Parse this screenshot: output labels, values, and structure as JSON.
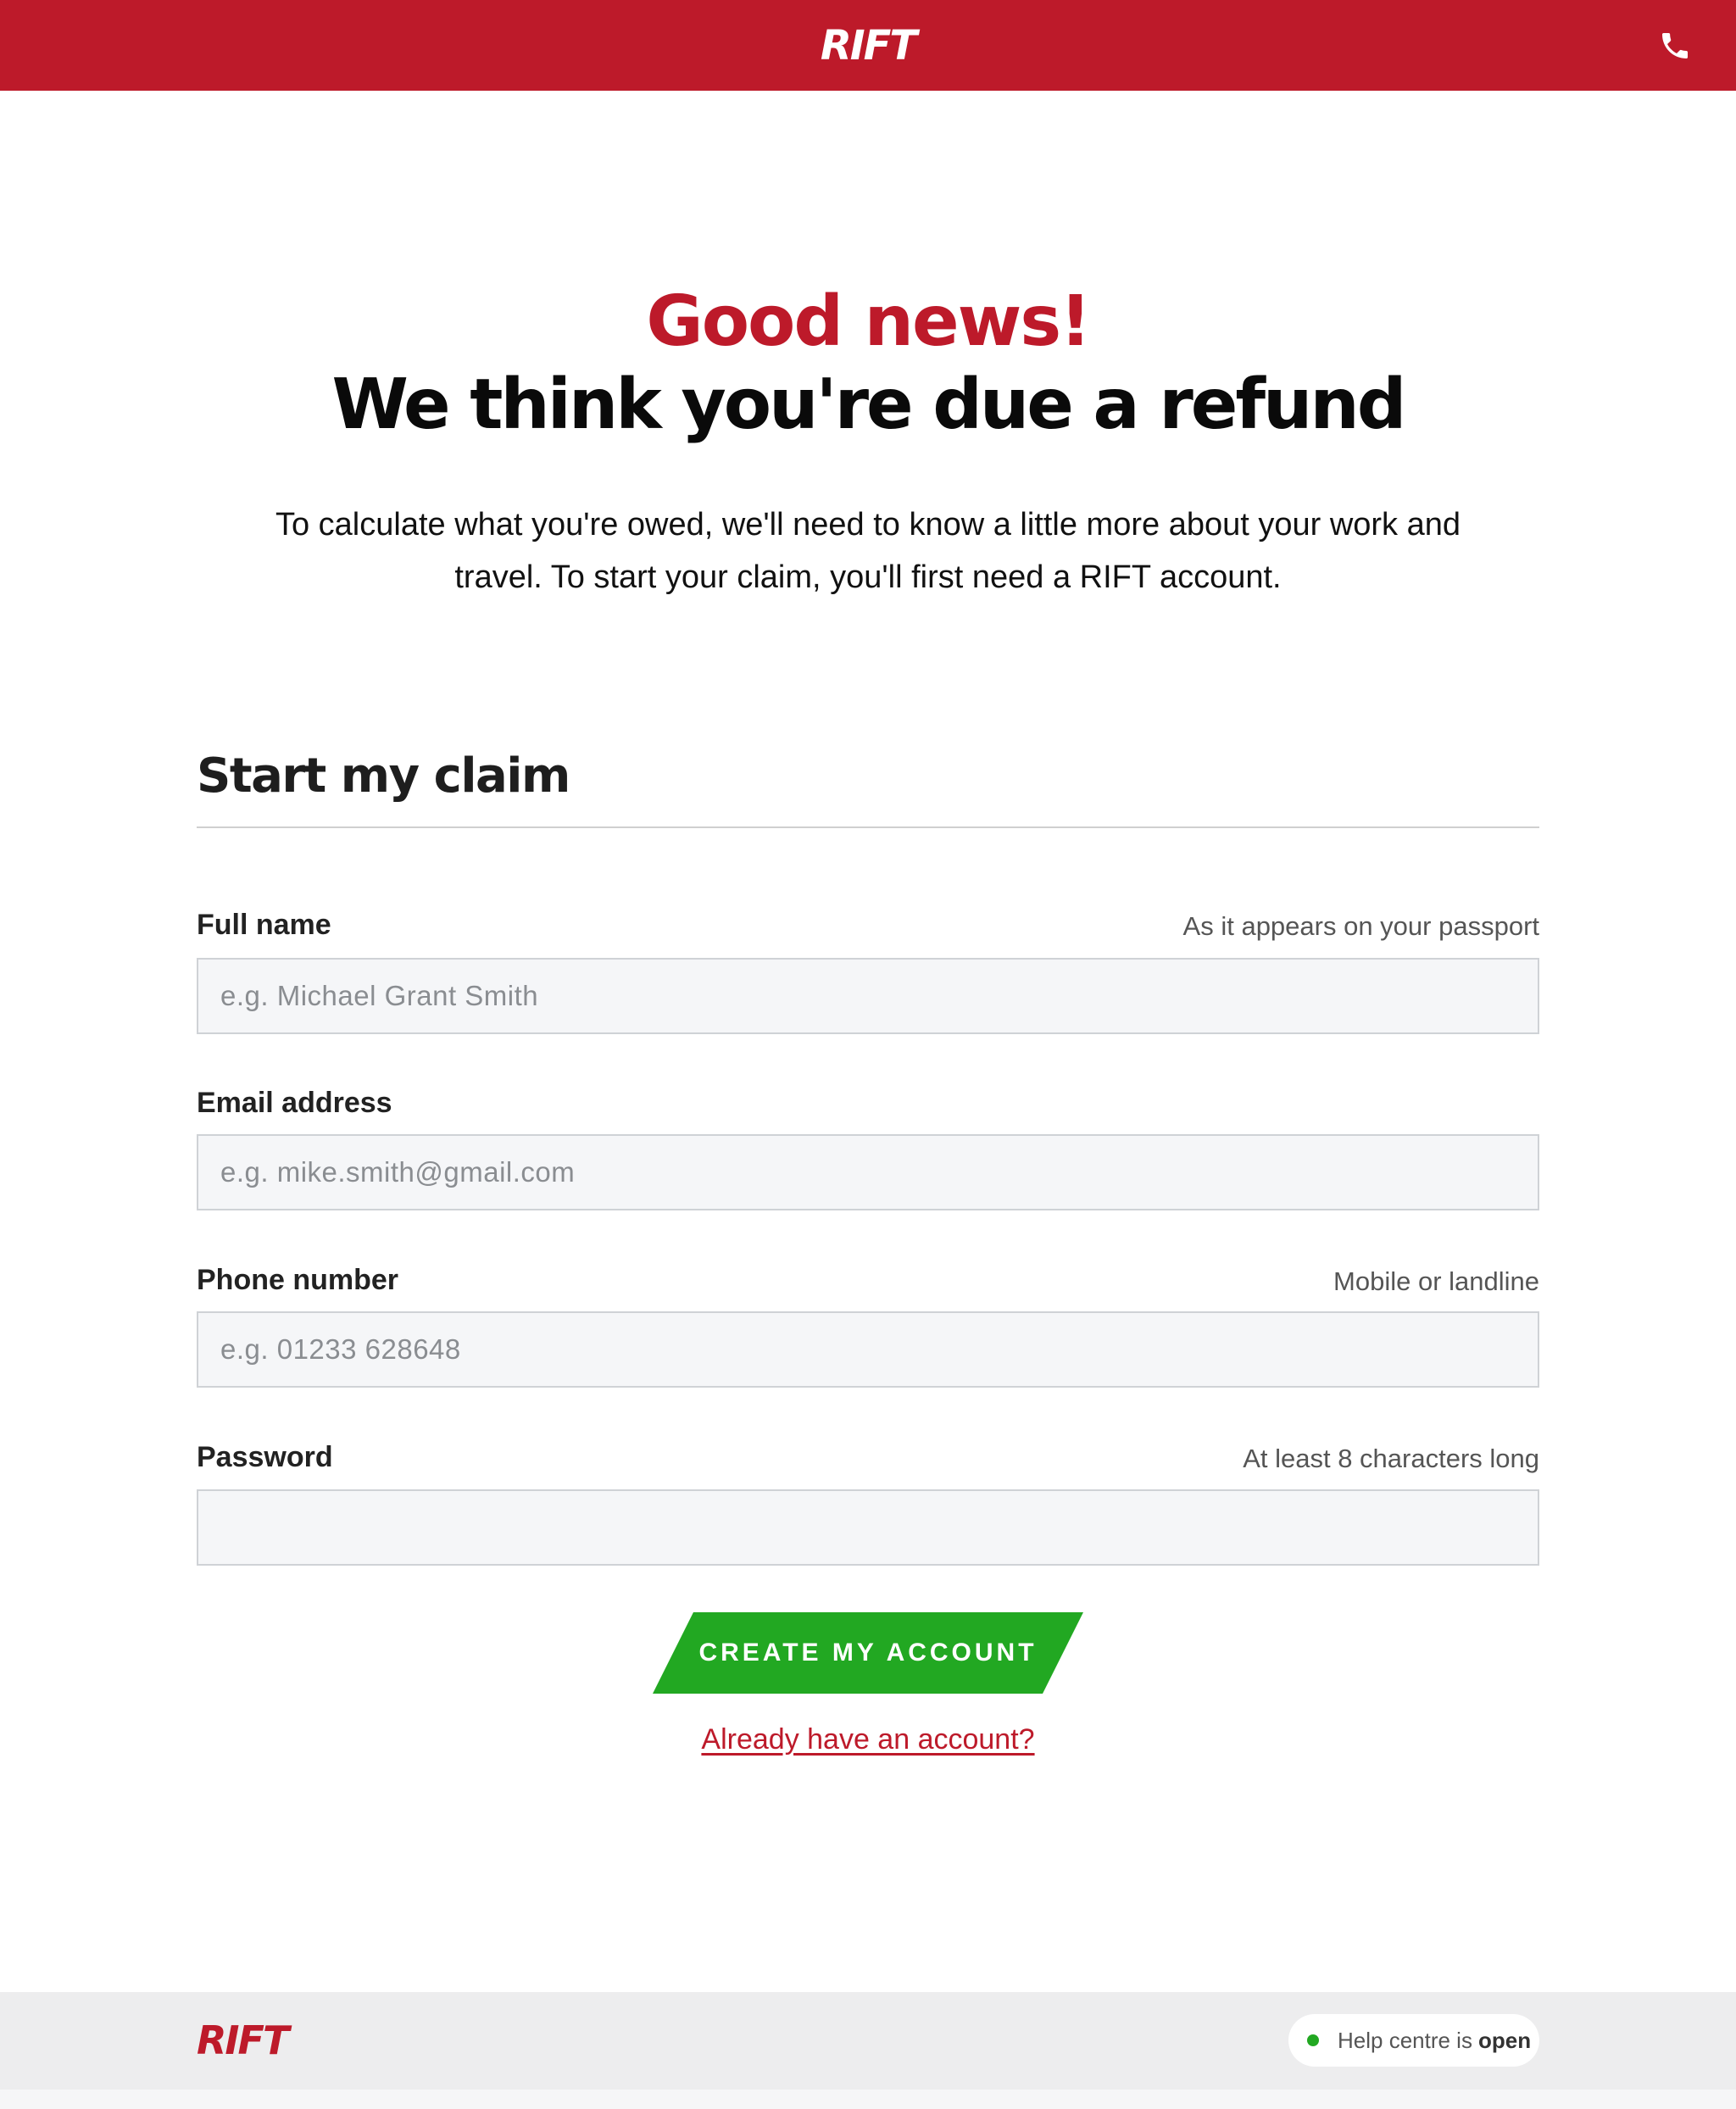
{
  "header": {
    "logo_text": "RIFT",
    "phone_icon": "phone-icon",
    "background_color": "#bd1a2a"
  },
  "hero": {
    "headline_accent": "Good news!",
    "headline": "We think you're due a refund",
    "intro": "To calculate what you're owed, we'll need to know a little more about your work and travel. To start your claim, you'll first need a RIFT account."
  },
  "form": {
    "title": "Start my claim",
    "fields": {
      "full_name": {
        "label": "Full name",
        "hint": "As it appears on your passport",
        "placeholder": "e.g. Michael Grant Smith",
        "value": ""
      },
      "email": {
        "label": "Email address",
        "hint": "",
        "placeholder": "e.g. mike.smith@gmail.com",
        "value": ""
      },
      "phone": {
        "label": "Phone number",
        "hint": "Mobile or landline",
        "placeholder": "e.g. 01233 628648",
        "value": ""
      },
      "password": {
        "label": "Password",
        "hint": "At least 8 characters long",
        "placeholder": "",
        "value": ""
      }
    },
    "submit_label": "CREATE MY ACCOUNT",
    "submit_color": "#22a822",
    "login_link": "Already have an account?"
  },
  "footer": {
    "logo_text": "RIFT",
    "help_text": "Help centre is",
    "help_status": "open",
    "status_color": "#22a822"
  }
}
